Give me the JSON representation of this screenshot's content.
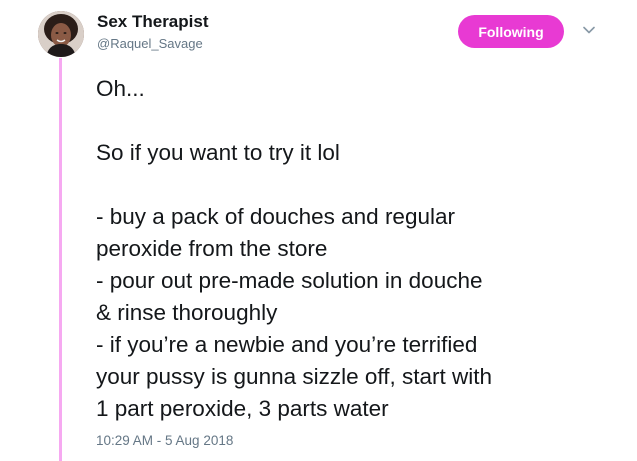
{
  "tweet": {
    "author": {
      "display_name": "Sex Therapist",
      "handle": "@Raquel_Savage"
    },
    "follow_button_label": "Following",
    "accent_color": "#e83ad3",
    "thread_line_color": "#f6a9f1",
    "lines": [
      "Oh...",
      "",
      "So if you want to try it lol",
      "",
      "- buy a pack of douches and regular",
      "peroxide from the store",
      "- pour out pre-made solution in douche",
      "& rinse thoroughly",
      "- if you’re a newbie and you’re terrified",
      "your pussy is gunna sizzle off, start with",
      "1 part peroxide, 3 parts water"
    ],
    "timestamp": "10:29 AM - 5 Aug 2018"
  },
  "icons": {
    "menu": "chevron-down-icon",
    "avatar": "profile-photo"
  }
}
